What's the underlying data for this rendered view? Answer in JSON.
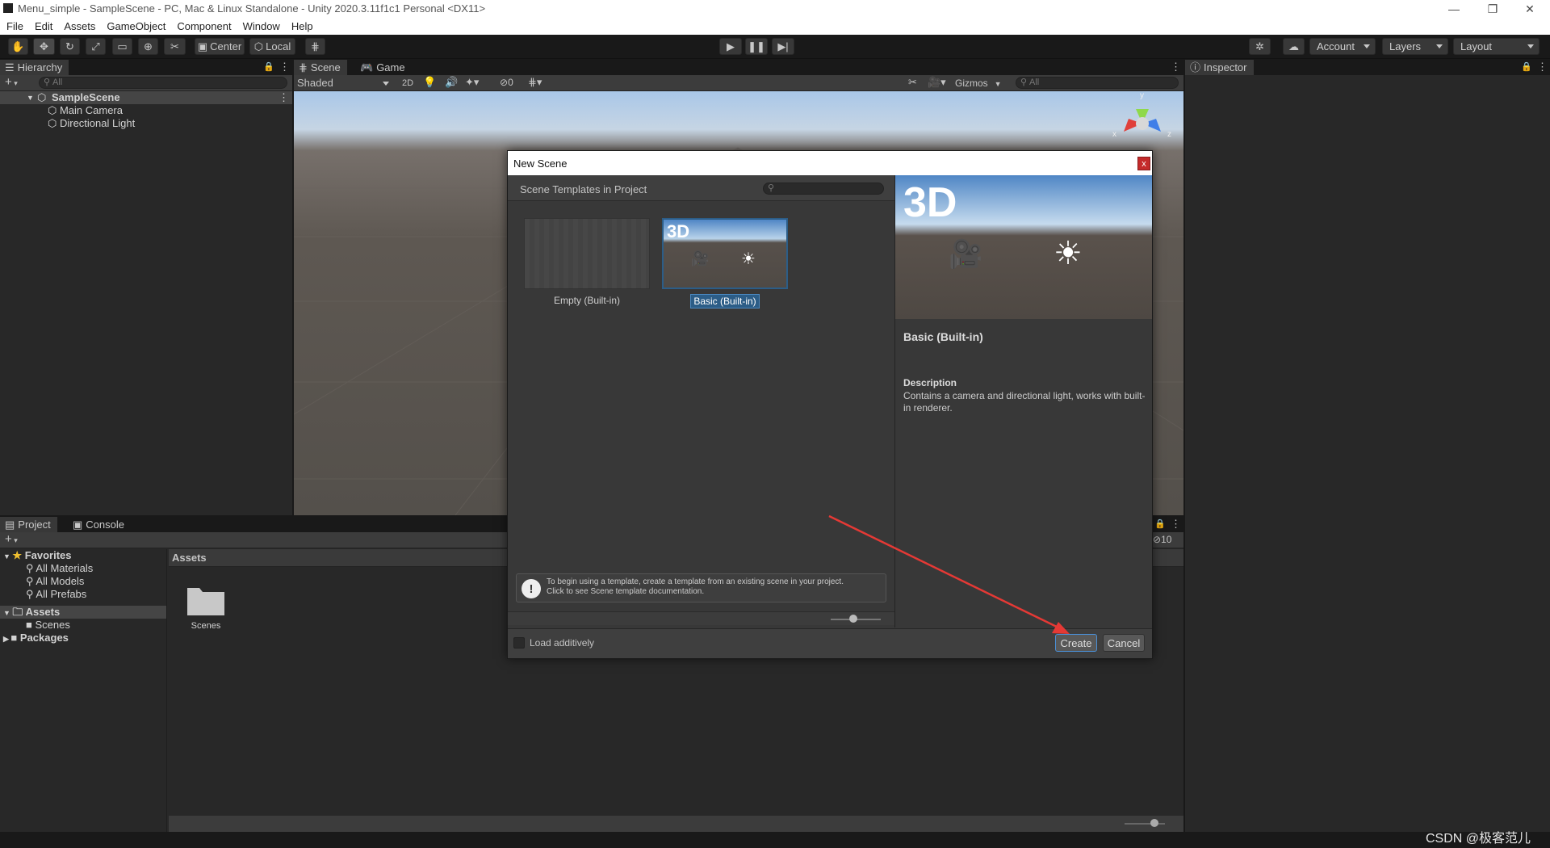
{
  "window": {
    "title": "Menu_simple - SampleScene - PC, Mac & Linux Standalone - Unity 2020.3.11f1c1 Personal <DX11>",
    "minimize": "—",
    "restore": "❐",
    "close": "✕"
  },
  "menu": [
    "File",
    "Edit",
    "Assets",
    "GameObject",
    "Component",
    "Window",
    "Help"
  ],
  "toolbar": {
    "pivot_label": "Center",
    "space_label": "Local",
    "account_label": "Account",
    "layers_label": "Layers",
    "layout_label": "Layout"
  },
  "hierarchy": {
    "tab": "Hierarchy",
    "add": "+",
    "search_placeholder": "All",
    "scene": "SampleScene",
    "items": [
      "Main Camera",
      "Directional Light"
    ]
  },
  "scene_view": {
    "tab_scene": "Scene",
    "tab_game": "Game",
    "shading": "Shaded",
    "mode_2d": "2D",
    "hidden_count": "0",
    "gizmos": "Gizmos",
    "search_placeholder": "All",
    "axis_x": "x",
    "axis_y": "y",
    "axis_z": "z"
  },
  "inspector": {
    "tab": "Inspector"
  },
  "project": {
    "tab_project": "Project",
    "tab_console": "Console",
    "add": "+",
    "hidden_count": "10",
    "favorites_label": "Favorites",
    "favorites": [
      "All Materials",
      "All Models",
      "All Prefabs"
    ],
    "assets_label": "Assets",
    "assets_children": [
      "Scenes"
    ],
    "packages_label": "Packages",
    "breadcrumb": "Assets",
    "grid_items": [
      "Scenes"
    ]
  },
  "dialog": {
    "title": "New Scene",
    "close": "x",
    "templates_header": "Scene Templates in Project",
    "templates": [
      {
        "label": "Empty (Built-in)",
        "selected": false
      },
      {
        "label": "Basic (Built-in)",
        "selected": true,
        "thumb_text": "3D"
      }
    ],
    "preview_text": "3D",
    "selected_name": "Basic (Built-in)",
    "description_label": "Description",
    "description": "Contains a camera and directional light, works with built-in renderer.",
    "info_line1": "To begin using a template, create a template from an existing scene in your project.",
    "info_line2": "Click to see Scene template documentation.",
    "load_additively": "Load additively",
    "create": "Create",
    "cancel": "Cancel"
  },
  "watermark": "CSDN @极客范儿",
  "colors": {
    "accent_red": "#e53935",
    "selection_blue": "#2c5d87",
    "dialog_bg": "#383838"
  }
}
